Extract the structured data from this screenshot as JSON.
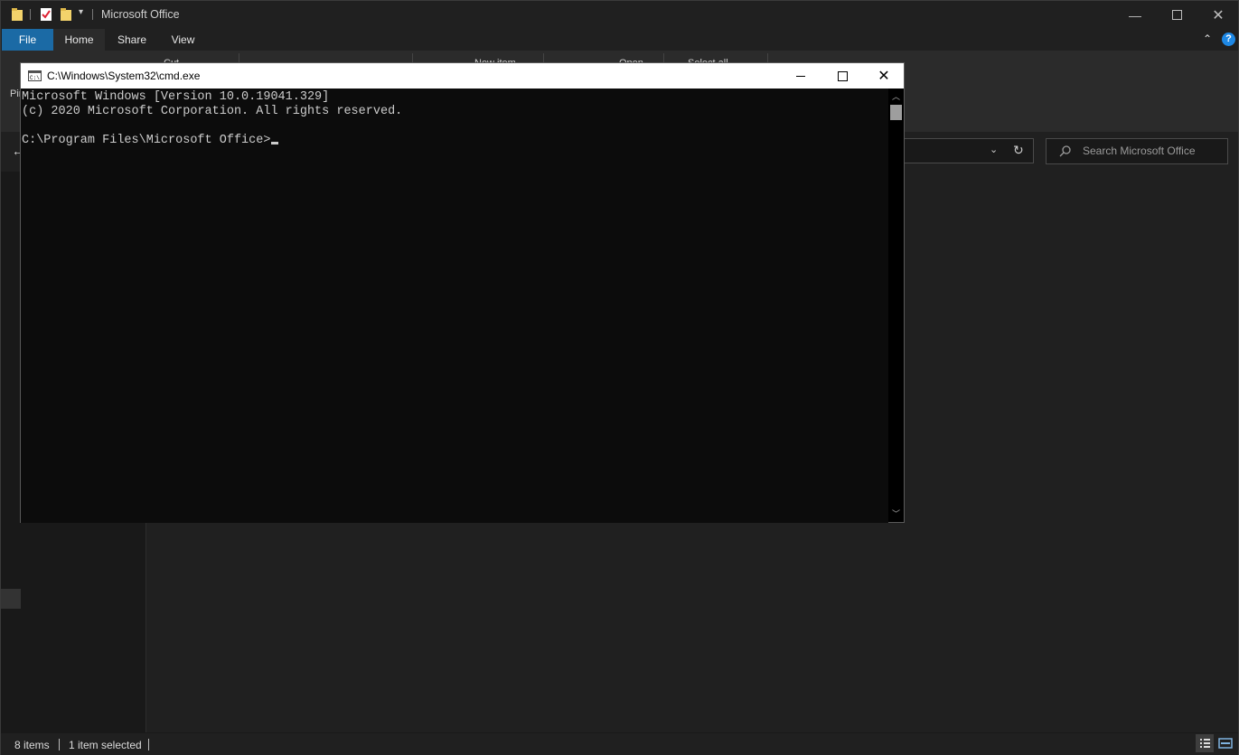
{
  "explorer": {
    "title": "Microsoft Office",
    "tabs": [
      "File",
      "Home",
      "Share",
      "View"
    ],
    "ribbon_labels": {
      "pin": "Pin",
      "cut": "Cut",
      "new_item": "New item",
      "open": "Open",
      "select_all": "Select all"
    },
    "search_placeholder": "Search Microsoft Office",
    "status": {
      "items": "8 items",
      "selected": "1 item selected"
    },
    "accent": "#1b6aa5"
  },
  "cmd": {
    "title": "C:\\Windows\\System32\\cmd.exe",
    "lines": [
      "Microsoft Windows [Version 10.0.19041.329]",
      "(c) 2020 Microsoft Corporation. All rights reserved.",
      "",
      "C:\\Program Files\\Microsoft Office>"
    ]
  }
}
